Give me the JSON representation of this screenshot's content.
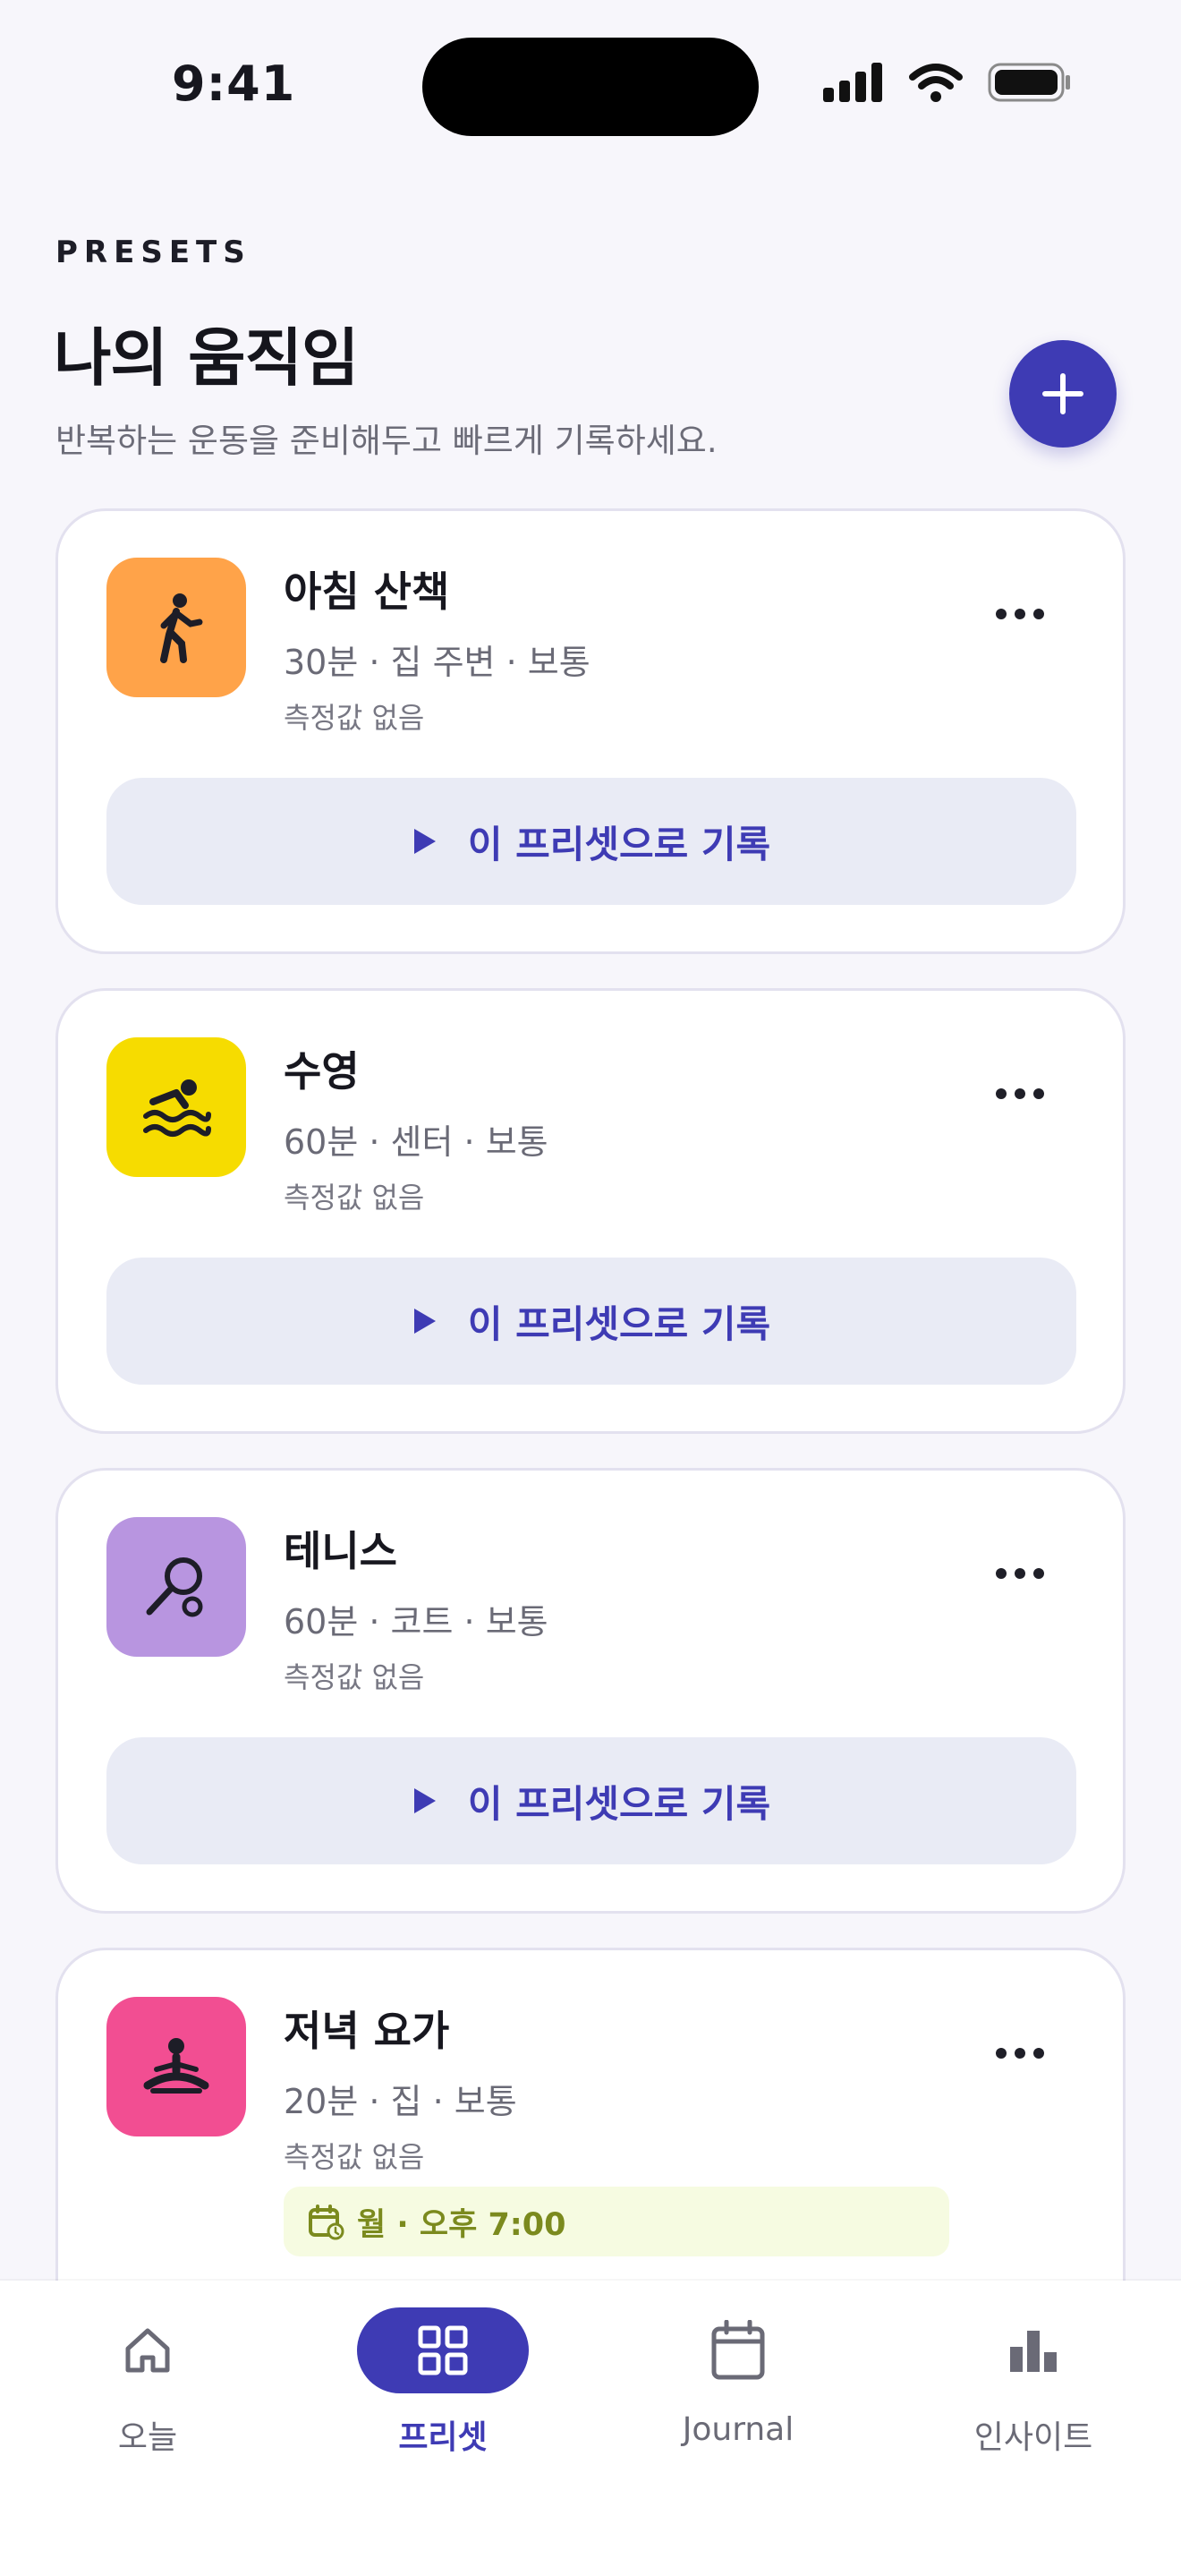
{
  "status_bar": {
    "time": "9:41"
  },
  "header": {
    "eyebrow": "PRESETS",
    "title": "나의 움직임",
    "subtitle": "반복하는 운동을 준비해두고 빠르게 기록하세요."
  },
  "colors": {
    "accent": "#3e3bb4",
    "walk": "#ffa349",
    "swim": "#f6dc00",
    "tennis": "#b895e0",
    "yoga": "#f24e92",
    "schedule_text": "#7b8a1e"
  },
  "presets": [
    {
      "title": "아침 산책",
      "meta": "30분 · 집 주변 · 보통",
      "sub": "측정값 없음",
      "icon": "walking-person-icon",
      "action": "이 프리셋으로 기록"
    },
    {
      "title": "수영",
      "meta": "60분 · 센터 · 보통",
      "sub": "측정값 없음",
      "icon": "swimmer-icon",
      "action": "이 프리셋으로 기록"
    },
    {
      "title": "테니스",
      "meta": "60분 · 코트 · 보통",
      "sub": "측정값 없음",
      "icon": "tennis-racket-icon",
      "action": "이 프리셋으로 기록"
    },
    {
      "title": "저녁 요가",
      "meta": "20분 · 집 · 보통",
      "sub": "측정값 없음",
      "icon": "meditation-icon",
      "schedule": "월 · 오후 7:00"
    }
  ],
  "tabs": [
    {
      "label": "오늘",
      "icon": "home-icon",
      "active": false
    },
    {
      "label": "프리셋",
      "icon": "grid-icon",
      "active": true
    },
    {
      "label": "Journal",
      "icon": "calendar-icon",
      "active": false
    },
    {
      "label": "인사이트",
      "icon": "bar-chart-icon",
      "active": false
    }
  ]
}
